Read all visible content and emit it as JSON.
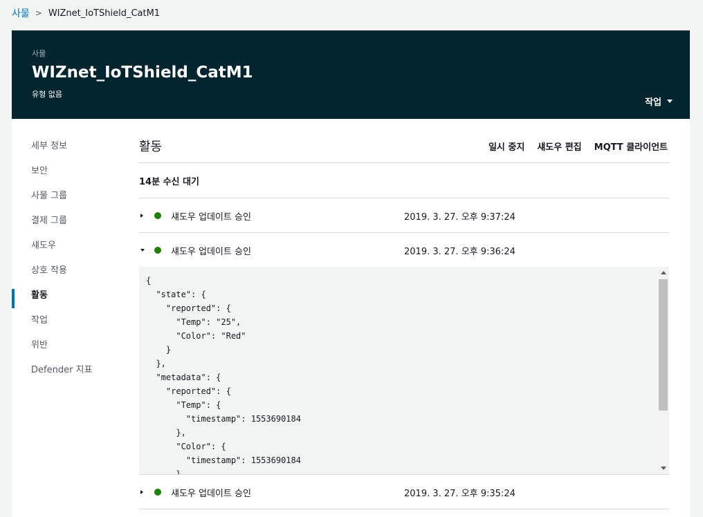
{
  "breadcrumb": {
    "parent": "사물",
    "current": "WIZnet_IoTShield_CatM1"
  },
  "header": {
    "small_label": "사물",
    "title": "WIZnet_IoTShield_CatM1",
    "subtitle": "유형 없음",
    "actions_label": "작업"
  },
  "sidenav": {
    "items": [
      {
        "label": "세부 정보"
      },
      {
        "label": "보안"
      },
      {
        "label": "사물 그룹"
      },
      {
        "label": "결제 그룹"
      },
      {
        "label": "섀도우"
      },
      {
        "label": "상호 작용"
      },
      {
        "label": "활동"
      },
      {
        "label": "작업"
      },
      {
        "label": "위반"
      },
      {
        "label": "Defender 지표"
      }
    ],
    "active": "활동"
  },
  "content": {
    "title": "활동",
    "links": {
      "pause": "일시 중지",
      "edit_shadow": "섀도우 편집",
      "mqtt_client": "MQTT 클라이언트"
    },
    "waiting": "14분 수신 대기",
    "events": [
      {
        "label": "섀도우 업데이트 승인",
        "time": "2019. 3. 27. 오후 9:37:24",
        "expanded": false
      },
      {
        "label": "섀도우 업데이트 승인",
        "time": "2019. 3. 27. 오후 9:36:24",
        "expanded": true
      },
      {
        "label": "섀도우 업데이트 승인",
        "time": "2019. 3. 27. 오후 9:35:24",
        "expanded": false
      }
    ],
    "payload": "{\n  \"state\": {\n    \"reported\": {\n      \"Temp\": \"25\",\n      \"Color\": \"Red\"\n    }\n  },\n  \"metadata\": {\n    \"reported\": {\n      \"Temp\": {\n        \"timestamp\": 1553690184\n      },\n      \"Color\": {\n        \"timestamp\": 1553690184\n      }"
  },
  "colors": {
    "header_bg": "#022530",
    "link": "#0073bb",
    "status_green": "#1d8102",
    "active_bar": "#0073bb"
  }
}
